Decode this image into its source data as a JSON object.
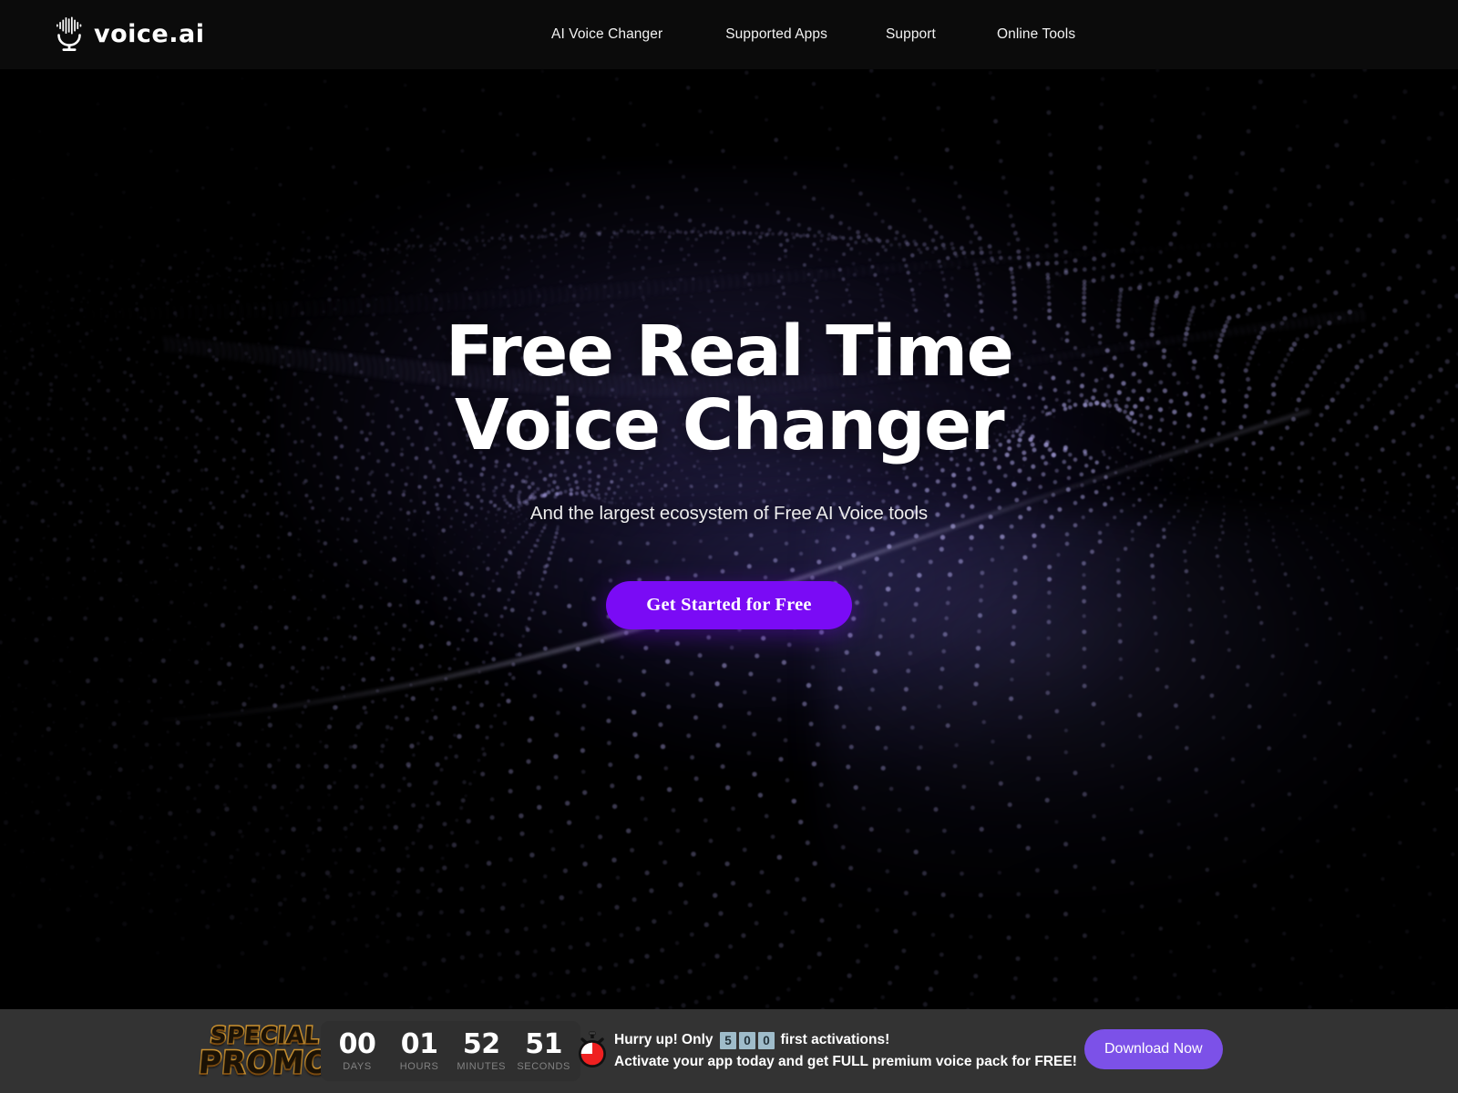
{
  "header": {
    "logo": {
      "icon": "microphone-waveform-icon",
      "wordmark": "voice.ai"
    },
    "nav": [
      {
        "label": "AI Voice Changer"
      },
      {
        "label": "Supported Apps"
      },
      {
        "label": "Support"
      },
      {
        "label": "Online Tools"
      }
    ]
  },
  "hero": {
    "title_line1": "Free Real Time",
    "title_line2": "Voice Changer",
    "subtitle": "And the largest ecosystem of Free AI Voice tools",
    "cta_label": "Get Started for Free"
  },
  "promo": {
    "badge_line1": "Special",
    "badge_line2": "Promo",
    "countdown": [
      {
        "value": "00",
        "label": "DAYS"
      },
      {
        "value": "01",
        "label": "HOURS"
      },
      {
        "value": "52",
        "label": "MINUTES"
      },
      {
        "value": "51",
        "label": "SECONDS"
      }
    ],
    "timer_icon": "stopwatch-icon",
    "message_prefix": "Hurry up! Only",
    "activation_digits": [
      "5",
      "0",
      "0"
    ],
    "message_suffix": "first activations!",
    "message_line2": "Activate your app today and get FULL premium voice pack for FREE!",
    "download_label": "Download Now"
  },
  "colors": {
    "page_background": "#000000",
    "header_background": "#0b0b0b",
    "cta_purple": "#7a0bf5",
    "download_purple": "#7c51e8",
    "promo_background": "#333333",
    "countdown_panel": "#2f2f2f",
    "countdown_label": "#828282",
    "digit_box": "#9fbcca",
    "promo_gold": "#c9902f",
    "wave_particle": "#8f86c8",
    "text_primary": "#ffffff"
  }
}
